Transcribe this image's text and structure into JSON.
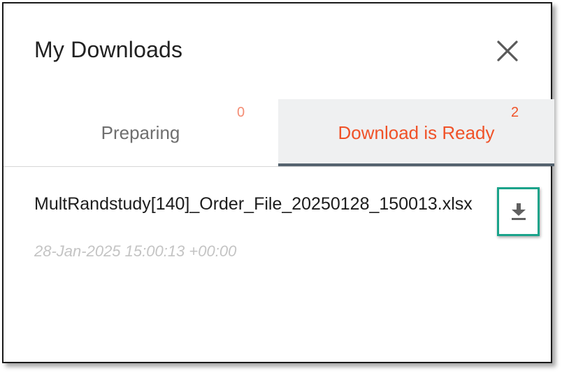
{
  "header": {
    "title": "My Downloads",
    "close_icon": "close-icon"
  },
  "tabs": [
    {
      "label": "Preparing",
      "count": "0",
      "active": false
    },
    {
      "label": "Download is Ready",
      "count": "2",
      "active": true
    }
  ],
  "downloads": [
    {
      "file_name": "MultRandstudy[140]_Order_File_20250128_150013.xlsx",
      "timestamp": "28-Jan-2025 15:00:13 +00:00",
      "action_icon": "download-icon"
    }
  ],
  "colors": {
    "accent": "#f05228",
    "highlight": "#1aa38a",
    "active_tab_bg": "#eff0f1",
    "active_tab_underline": "#55636f"
  }
}
